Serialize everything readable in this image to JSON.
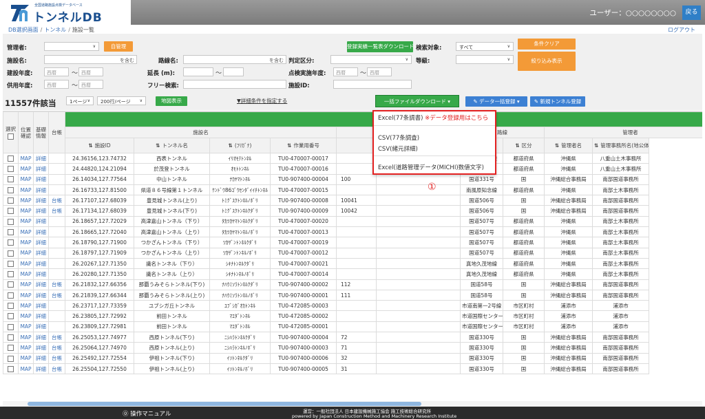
{
  "header": {
    "logo_sub": "全国道路施設点検データベース",
    "logo_title": "トンネルDB",
    "user": "ユーザー：○○○○○○○○",
    "back": "戻る"
  },
  "breadcrumb": {
    "items": [
      "DB選択画面",
      "トンネル",
      "施設一覧"
    ],
    "logout": "ログアウト"
  },
  "search": {
    "manager_label": "管理者:",
    "manager_btn": "自管理",
    "facility_label": "施設名:",
    "facility_contains": "を含む",
    "route_label": "路線名:",
    "route_contains": "を含む",
    "judge_label": "判定区分:",
    "grade_label": "等級:",
    "target_label": "検索対象:",
    "target_value": "すべて",
    "built_label": "建設年度:",
    "inspect_label": "点検実施年度:",
    "used_label": "供用年度:",
    "length_label": "延長 (m):",
    "free_label": "フリー検索:",
    "facility_id_label": "施設ID:",
    "year_ph": "西暦",
    "tilde": "〜",
    "reg_btn": "登録実績一覧表ダウンロード",
    "clear_btn": "条件クリア",
    "filter_btn": "絞り込み表示"
  },
  "toolbar": {
    "count": "11557件該当",
    "page": "1ページ",
    "per_page": "200行/ページ",
    "map_btn": "地図表示",
    "detail_link": "▼詳細条件を指定する",
    "bulk_dl": "一括ファイルダウンロード ▾",
    "bulk_reg": "データ一括登録 ▾",
    "new_reg": "新規トンネル登録"
  },
  "dropdown": {
    "item1": "Excel(77条調書)",
    "item1_note": "※データ登録用はこちら",
    "item2": "CSV(77条調査)",
    "item3": "CSV(緒元詳細)",
    "item4": "Excel(道路管理データ(MICHI)数値文字)",
    "marker": "①"
  },
  "table": {
    "h_select": "選択",
    "h_pos": "位置確認",
    "h_basic": "基礎情報",
    "h_ledger": "台帳",
    "h_facility": "施設名",
    "h_spec": "諸元",
    "h_route_grp": "路線",
    "h_manager_grp": "管理者",
    "cols": [
      "施設ID",
      "トンネル名",
      "(ﾌﾘｶﾞﾅ)",
      "作業用番号",
      "",
      "",
      "路線名",
      "区分",
      "管理者名",
      "管理事務所名(地公体は任意)"
    ],
    "rows": [
      {
        "id": "24.36156,123.74732",
        "name": "西表トンネル",
        "kana": "ｲﾘｵﾓﾃﾄﾝﾈﾙ",
        "work": "TU0-470007-00017",
        "n": "",
        "route": "白浜南風見線",
        "div": "都道府県",
        "mgr": "沖縄県",
        "office": "八重山土木事務所",
        "d": false
      },
      {
        "id": "24.44820,124.21094",
        "name": "於茂登トンネル",
        "kana": "ｵﾓﾄﾄﾝﾈﾙ",
        "work": "TU0-470007-00016",
        "n": "",
        "route": "桴海大川線",
        "div": "都道府県",
        "mgr": "沖縄県",
        "office": "八重山土木事務所",
        "d": false
      },
      {
        "id": "26.14034,127.77564",
        "name": "中山トンネル",
        "kana": "ﾅｶﾔﾏﾄﾝﾈﾙ",
        "work": "TU0-907400-00004",
        "n": "100",
        "route": "国道331号",
        "div": "国",
        "mgr": "沖縄総合事務局",
        "office": "南部国道事務所",
        "d": false
      },
      {
        "id": "26.16733,127.81500",
        "name": "県道８６号線第１トンネル",
        "kana": "ｹﾝﾄﾞｳ86ｺﾞｳｾﾝﾀﾞｲｲﾁﾄﾝﾈﾙ",
        "work": "TU0-470007-00015",
        "n": "",
        "route": "南風原知念線",
        "div": "都道府県",
        "mgr": "沖縄県",
        "office": "南部土木事務所",
        "d": false
      },
      {
        "id": "26.17107,127.68039",
        "name": "豊見城トンネル(上り)",
        "kana": "ﾄﾐｸﾞｽｸﾄﾝﾈﾙﾉﾎﾞﾘ",
        "work": "TU0-907400-00008",
        "n": "10041",
        "route": "国道506号",
        "div": "国",
        "mgr": "沖縄総合事務局",
        "office": "南部国道事務所",
        "d": true
      },
      {
        "id": "26.17134,127.68039",
        "name": "豊見城トンネル(下り)",
        "kana": "ﾄﾐｸﾞｽｸﾄﾝﾈﾙｸﾀﾞﾘ",
        "work": "TU0-907400-00009",
        "n": "10042",
        "route": "国道506号",
        "div": "国",
        "mgr": "沖縄総合事務局",
        "office": "南部国道事務所",
        "d": true
      },
      {
        "id": "26.18657,127.72029",
        "name": "高津嘉山トンネル（下り）",
        "kana": "ﾀｶﾂｶﾔﾏﾄﾝﾈﾙｸﾀﾞﾘ",
        "work": "TU0-470007-00020",
        "n": "",
        "route": "国道507号",
        "div": "都道府県",
        "mgr": "沖縄県",
        "office": "南部土木事務所",
        "d": false
      },
      {
        "id": "26.18665,127.72040",
        "name": "高津嘉山トンネル（上り）",
        "kana": "ﾀｶﾂｶﾔﾏﾄﾝﾈﾙﾉﾎﾞﾘ",
        "work": "TU0-470007-00013",
        "n": "",
        "route": "国道507号",
        "div": "都道府県",
        "mgr": "沖縄県",
        "office": "南部土木事務所",
        "d": false
      },
      {
        "id": "26.18790,127.71900",
        "name": "つかざんトンネル（下り）",
        "kana": "ﾂｶｻﾞﾝﾄﾝﾈﾙｸﾀﾞﾘ",
        "work": "TU0-470007-00019",
        "n": "",
        "route": "国道507号",
        "div": "都道府県",
        "mgr": "沖縄県",
        "office": "南部土木事務所",
        "d": false
      },
      {
        "id": "26.18797,127.71909",
        "name": "つかざんトンネル（上り）",
        "kana": "ﾂｶｻﾞﾝﾄﾝﾈﾙﾉﾎﾞﾘ",
        "work": "TU0-470007-00012",
        "n": "",
        "route": "国道507号",
        "div": "都道府県",
        "mgr": "沖縄県",
        "office": "南部土木事務所",
        "d": false
      },
      {
        "id": "26.20267,127.71350",
        "name": "識名トンネル（下り）",
        "kana": "ｼｷﾅﾄﾝﾈﾙｸﾀﾞﾘ",
        "work": "TU0-470007-00021",
        "n": "",
        "route": "真地久茂地線",
        "div": "都道府県",
        "mgr": "沖縄県",
        "office": "南部土木事務所",
        "d": false
      },
      {
        "id": "26.20280,127.71350",
        "name": "識名トンネル（上り）",
        "kana": "ｼｷﾅﾄﾝﾈﾙﾉﾎﾞﾘ",
        "work": "TU0-470007-00014",
        "n": "",
        "route": "真地久茂地線",
        "div": "都道府県",
        "mgr": "沖縄県",
        "office": "南部土木事務所",
        "d": false
      },
      {
        "id": "26.21832,127.66356",
        "name": "那覇うみそらトンネル(下り)",
        "kana": "ﾅﾊｳﾐｿﾗﾄﾝﾈﾙｸﾀﾞﾘ",
        "work": "TU0-907400-00002",
        "n": "112",
        "route": "国道58号",
        "div": "国",
        "mgr": "沖縄総合事務局",
        "office": "南部国道事務所",
        "d": true
      },
      {
        "id": "26.21839,127.66344",
        "name": "那覇うみそらトンネル(上り)",
        "kana": "ﾅﾊｳﾐｿﾗﾄﾝﾈﾙﾉﾎﾞﾘ",
        "work": "TU0-907400-00001",
        "n": "111",
        "route": "国道58号",
        "div": "国",
        "mgr": "沖縄総合事務局",
        "office": "南部国道事務所",
        "d": true
      },
      {
        "id": "26.23717,127.73359",
        "name": "ユブシガ丘トンネル",
        "kana": "ﾕﾌﾞｼｶﾞｵｶﾄﾝﾈﾙ",
        "work": "TU0-472085-00003",
        "n": "",
        "route": "市道南第一2号線",
        "div": "市区町村",
        "mgr": "浦添市",
        "office": "浦添市",
        "d": false
      },
      {
        "id": "26.23805,127.72992",
        "name": "前田トンネル",
        "kana": "ﾏｴﾀﾞﾄﾝﾈﾙ",
        "work": "TU0-472085-00002",
        "n": "",
        "route": "市道国際センター線",
        "div": "市区町村",
        "mgr": "浦添市",
        "office": "浦添市",
        "d": false
      },
      {
        "id": "26.23809,127.72981",
        "name": "前田トンネル",
        "kana": "ﾏｴﾀﾞﾄﾝﾈﾙ",
        "work": "TU0-472085-00001",
        "n": "",
        "route": "市道国際センター線",
        "div": "市区町村",
        "mgr": "浦添市",
        "office": "浦添市",
        "d": false
      },
      {
        "id": "26.25053,127.74977",
        "name": "西原トンネル(下り)",
        "kana": "ﾆｼﾊﾗﾄﾝﾈﾙｸﾀﾞﾘ",
        "work": "TU0-907400-00004",
        "n": "72",
        "route": "国道330号",
        "div": "国",
        "mgr": "沖縄総合事務局",
        "office": "南部国道事務所",
        "d": true
      },
      {
        "id": "26.25064,127.74970",
        "name": "西原トンネル(上り)",
        "kana": "ﾆｼﾊﾗﾄﾝﾈﾙﾉﾎﾞﾘ",
        "work": "TU0-907400-00003",
        "n": "71",
        "route": "国道330号",
        "div": "国",
        "mgr": "沖縄総合事務局",
        "office": "南部国道事務所",
        "d": true
      },
      {
        "id": "26.25492,127.72554",
        "name": "伊祖トンネル(下り)",
        "kana": "ｲｿﾄﾝﾈﾙｸﾀﾞﾘ",
        "work": "TU0-907400-00006",
        "n": "32",
        "route": "国道330号",
        "div": "国",
        "mgr": "沖縄総合事務局",
        "office": "南部国道事務所",
        "d": true
      },
      {
        "id": "26.25504,127.72550",
        "name": "伊祖トンネル(上り)",
        "kana": "ｲｿﾄﾝﾈﾙﾉﾎﾞﾘ",
        "work": "TU0-907400-00005",
        "n": "31",
        "route": "国道330号",
        "div": "国",
        "mgr": "沖縄総合事務局",
        "office": "南部国道事務所",
        "d": true
      }
    ],
    "map_label": "MAP",
    "detail_label": "詳細",
    "ledger_label": "台帳",
    "sort_icon": "⇅"
  },
  "footer": {
    "manual": "⓪ 操作マニュアル",
    "operator": "運営：一般社団法人 日本建設機械施工協会 施工技術総合研究所",
    "powered": "powered by Japan Construction Method and Machinery Research Institute"
  },
  "colors": {
    "orange": "#f39a37",
    "green": "#37a949",
    "blue": "#3c80d3",
    "highlight": "#e32020"
  }
}
